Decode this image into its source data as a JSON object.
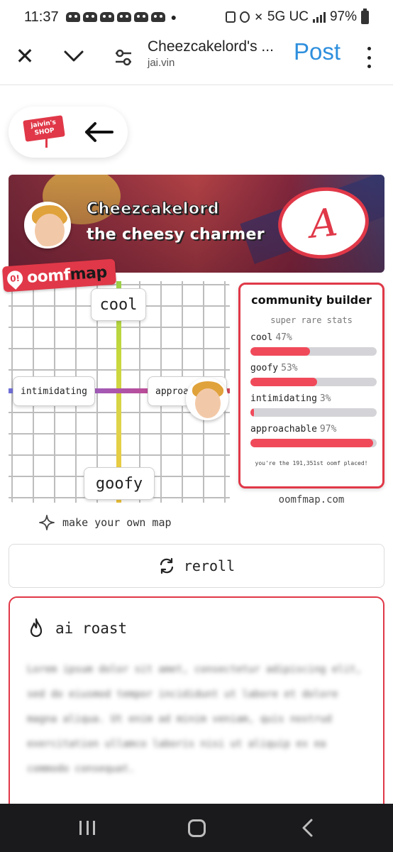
{
  "status_bar": {
    "time": "11:37",
    "network": "5G UC",
    "battery": "97%",
    "notification_icons": [
      "discord-icon",
      "discord-icon",
      "discord-icon",
      "discord-icon",
      "discord-icon",
      "discord-icon"
    ]
  },
  "toolbar": {
    "title": "Cheezcakelord's ...",
    "url": "jai.vin",
    "post_label": "Post"
  },
  "shop": {
    "logo_text": "jaivin's SHOP"
  },
  "banner": {
    "name": "Cheezcakelord",
    "tagline": "the cheesy charmer",
    "grade": "A",
    "colors": {
      "accent": "#e03848"
    }
  },
  "oomfmap": {
    "brand_prefix": "oomf",
    "brand_suffix": "map",
    "pin_symbol": "0!",
    "labels": {
      "top": "cool",
      "bottom": "goofy",
      "left": "intimidating",
      "right": "approachable"
    }
  },
  "stats": {
    "title": "community builder",
    "subtitle": "super rare stats",
    "items": [
      {
        "label": "cool",
        "percent": "47%",
        "value": 47
      },
      {
        "label": "goofy",
        "percent": "53%",
        "value": 53
      },
      {
        "label": "intimidating",
        "percent": "3%",
        "value": 3
      },
      {
        "label": "approachable",
        "percent": "97%",
        "value": 97
      }
    ],
    "footer": "you're the 191,351st oomf placed!",
    "site": "oomfmap.com"
  },
  "actions": {
    "make_map": "make your own map",
    "reroll": "reroll"
  },
  "roast": {
    "title": "ai roast",
    "body": "Lorem ipsum dolor sit amet, consectetur adipiscing elit, sed do eiusmod tempor incididunt ut labore et dolore magna aliqua. Ut enim ad minim veniam, quis nostrud exercitation ullamco laboris nisi ut aliquip ex ea commodo consequat."
  }
}
